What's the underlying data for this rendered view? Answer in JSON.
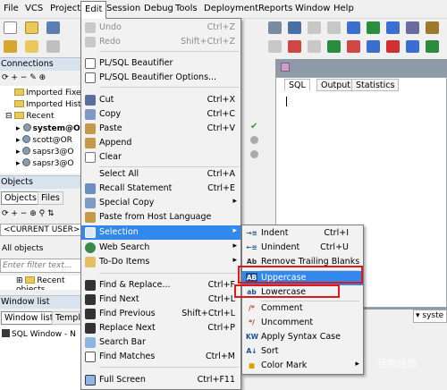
{
  "menubar": [
    "File",
    "VCS",
    "Project",
    "Edit",
    "Session",
    "Debug",
    "Tools",
    "Deployment",
    "Reports",
    "Window",
    "Help"
  ],
  "left": {
    "connections_title": "Connections",
    "tree": [
      "Imported Fixed",
      "Imported Histo",
      "Recent",
      "system@O",
      "scott@OR",
      "sapsr3@O",
      "sapsr3@O"
    ],
    "objects_title": "Objects",
    "objects_tabs": [
      "Objects",
      "Files"
    ],
    "current_user": "<CURRENT USER>",
    "all_objects": "All objects",
    "filter_placeholder": "Enter filter text...",
    "recent_objects": "Recent objects",
    "window_list_title": "Window list",
    "window_tabs": [
      "Window list",
      "Templ"
    ],
    "window_item": "SQL Window - N"
  },
  "editor": {
    "tabs": [
      "SQL",
      "Output",
      "Statistics"
    ],
    "dropdown_text": "syste"
  },
  "edit_menu": [
    {
      "label": "Undo",
      "shortcut": "Ctrl+Z",
      "disabled": true,
      "icon": "undo-icon"
    },
    {
      "label": "Redo",
      "shortcut": "Shift+Ctrl+Z",
      "disabled": true,
      "icon": "redo-icon"
    },
    {
      "label": "PL/SQL Beautifier",
      "shortcut": "",
      "icon": "beautifier-icon"
    },
    {
      "label": "PL/SQL Beautifier Options...",
      "shortcut": "",
      "icon": "beautifier-options-icon"
    },
    {
      "label": "Cut",
      "shortcut": "Ctrl+X",
      "icon": "cut-icon"
    },
    {
      "label": "Copy",
      "shortcut": "Ctrl+C",
      "icon": "copy-icon"
    },
    {
      "label": "Paste",
      "shortcut": "Ctrl+V",
      "icon": "paste-icon"
    },
    {
      "label": "Append",
      "shortcut": "",
      "icon": "append-icon"
    },
    {
      "label": "Clear",
      "shortcut": "",
      "icon": "clear-icon"
    },
    {
      "label": "Select All",
      "shortcut": "Ctrl+A",
      "icon": "select-all-icon"
    },
    {
      "label": "Recall Statement",
      "shortcut": "Ctrl+E",
      "icon": "recall-icon"
    },
    {
      "label": "Special Copy",
      "shortcut": "",
      "submenu": true,
      "icon": "special-copy-icon"
    },
    {
      "label": "Paste from Host Language",
      "shortcut": "",
      "icon": "paste-host-icon"
    },
    {
      "label": "Selection",
      "shortcut": "",
      "submenu": true,
      "highlighted": true,
      "icon": "selection-icon"
    },
    {
      "label": "Web Search",
      "shortcut": "",
      "submenu": true,
      "icon": "web-search-icon"
    },
    {
      "label": "To-Do Items",
      "shortcut": "",
      "submenu": true,
      "icon": "todo-icon"
    },
    {
      "label": "Find & Replace...",
      "shortcut": "Ctrl+F",
      "icon": "find-replace-icon"
    },
    {
      "label": "Find Next",
      "shortcut": "Ctrl+L",
      "icon": "find-next-icon"
    },
    {
      "label": "Find Previous",
      "shortcut": "Shift+Ctrl+L",
      "icon": "find-previous-icon"
    },
    {
      "label": "Replace Next",
      "shortcut": "Ctrl+P",
      "icon": "replace-next-icon"
    },
    {
      "label": "Search Bar",
      "shortcut": "",
      "icon": "search-bar-icon"
    },
    {
      "label": "Find Matches",
      "shortcut": "Ctrl+M",
      "icon": "find-matches-icon"
    },
    {
      "label": "Full Screen",
      "shortcut": "Ctrl+F11",
      "icon": "full-screen-icon"
    }
  ],
  "selection_menu": [
    {
      "label": "Indent",
      "shortcut": "Ctrl+I",
      "icon": "indent-icon",
      "glyph": "→≡"
    },
    {
      "label": "Unindent",
      "shortcut": "Ctrl+U",
      "icon": "unindent-icon",
      "glyph": "←≡"
    },
    {
      "label": "Remove Trailing Blanks",
      "shortcut": "",
      "icon": "remove-blanks-icon",
      "glyph": "Ab"
    },
    {
      "label": "Uppercase",
      "shortcut": "",
      "icon": "uppercase-icon",
      "glyph": "AB",
      "highlighted": true
    },
    {
      "label": "Lowercase",
      "shortcut": "",
      "icon": "lowercase-icon",
      "glyph": "ab"
    },
    {
      "label": "Comment",
      "shortcut": "",
      "icon": "comment-icon",
      "glyph": "/*"
    },
    {
      "label": "Uncomment",
      "shortcut": "",
      "icon": "uncomment-icon",
      "glyph": "*/"
    },
    {
      "label": "Apply Syntax Case",
      "shortcut": "",
      "icon": "syntax-case-icon",
      "glyph": "KW"
    },
    {
      "label": "Sort",
      "shortcut": "",
      "icon": "sort-icon",
      "glyph": "A↓"
    },
    {
      "label": "Color Mark",
      "shortcut": "",
      "icon": "color-mark-icon",
      "glyph": "■",
      "submenu": true
    }
  ],
  "watermark": "百度经验"
}
